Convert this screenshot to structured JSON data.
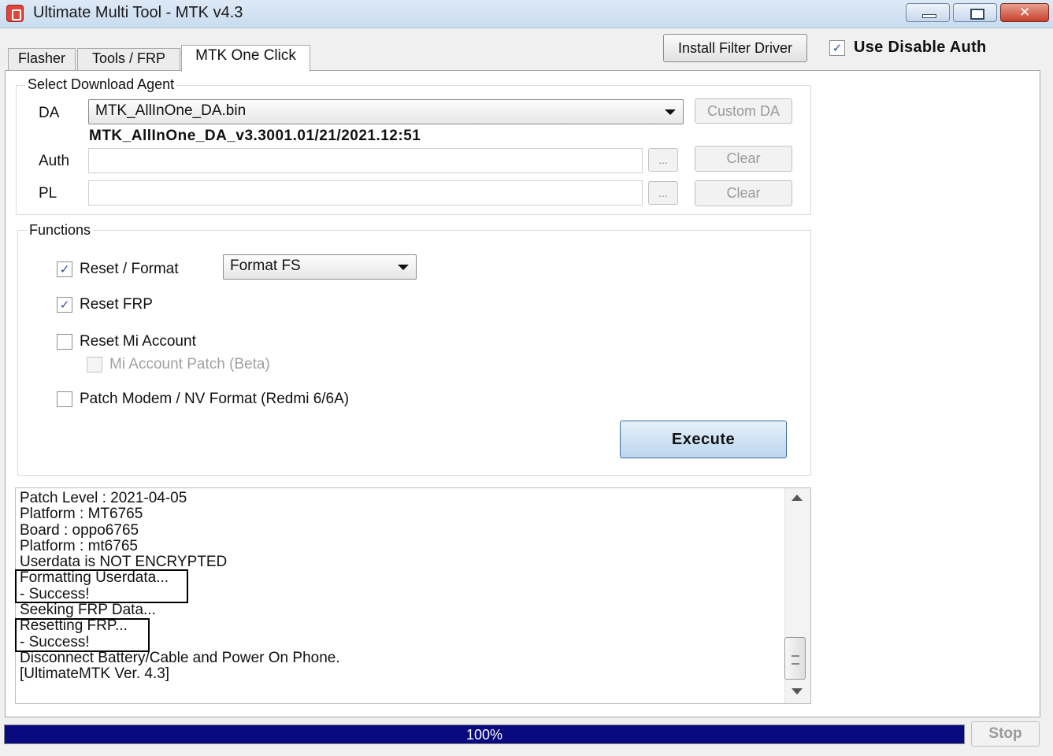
{
  "window": {
    "title": "Ultimate Multi Tool - MTK v4.3"
  },
  "toolbar": {
    "install_filter_driver": "Install Filter Driver",
    "use_disable_auth": {
      "label": "Use Disable Auth",
      "checked": true
    }
  },
  "tabs": [
    {
      "label": "Flasher",
      "active": false
    },
    {
      "label": "Tools / FRP",
      "active": false
    },
    {
      "label": "MTK One Click",
      "active": true
    }
  ],
  "download_agent": {
    "group_title": "Select Download Agent",
    "da_label": "DA",
    "da_selected": "MTK_AllInOne_DA.bin",
    "custom_da": "Custom DA",
    "da_version": "MTK_AllInOne_DA_v3.3001.01/21/2021.12:51",
    "auth_label": "Auth",
    "auth_value": "",
    "pl_label": "PL",
    "pl_value": "",
    "browse": "...",
    "clear": "Clear"
  },
  "functions": {
    "group_title": "Functions",
    "reset_format": {
      "label": "Reset / Format",
      "checked": true
    },
    "format_mode": "Format FS",
    "reset_frp": {
      "label": "Reset FRP",
      "checked": true
    },
    "reset_mi_account": {
      "label": "Reset Mi Account",
      "checked": false
    },
    "mi_account_patch": {
      "label": "Mi Account Patch (Beta)",
      "checked": false,
      "enabled": false
    },
    "patch_modem": {
      "label": "Patch Modem / NV Format (Redmi 6/6A)",
      "checked": false
    },
    "execute": "Execute"
  },
  "log": {
    "lines": [
      "Patch Level : 2021-04-05",
      "Platform : MT6765",
      "Board : oppo6765",
      "Platform : mt6765",
      "Userdata is NOT ENCRYPTED",
      "Formatting Userdata...",
      "- Success!",
      "Seeking FRP Data...",
      "Resetting FRP...",
      "- Success!",
      "Disconnect Battery/Cable and Power On Phone.",
      "[UltimateMTK Ver. 4.3]"
    ]
  },
  "status": {
    "progress_percent": 100,
    "progress_text": "100%",
    "stop": "Stop"
  },
  "colors": {
    "progress_fill": "#0a0a80",
    "check_mark": "#2f4f8f"
  },
  "icons": {
    "app": "app-icon",
    "minimize": "minimize-icon",
    "maximize": "maximize-icon",
    "close": "close-icon",
    "dropdown": "chevron-down-icon",
    "check": "check-icon"
  }
}
